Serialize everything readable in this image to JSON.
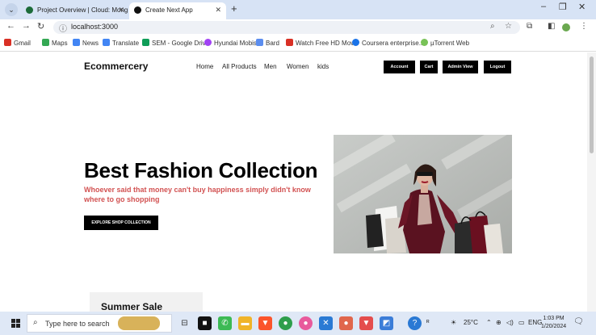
{
  "browser": {
    "tabs": [
      {
        "title": "Project Overview | Cloud: Mong",
        "active": false
      },
      {
        "title": "Create Next App",
        "active": true
      }
    ],
    "new_tab": "+",
    "address": "localhost:3000",
    "bookmarks": [
      {
        "label": "Gmail",
        "icon": "gmail-icon",
        "color": "#d93025"
      },
      {
        "label": "Maps",
        "icon": "maps-icon",
        "color": "#34a853"
      },
      {
        "label": "News",
        "icon": "news-icon",
        "color": "#4285f4"
      },
      {
        "label": "Translate",
        "icon": "translate-icon",
        "color": "#4285f4"
      },
      {
        "label": "SEM - Google Drive",
        "icon": "drive-icon",
        "color": "#0f9d58"
      },
      {
        "label": "Hyundai Mobis",
        "icon": "hyundai-icon",
        "color": "#a142f4"
      },
      {
        "label": "Bard",
        "icon": "bard-icon",
        "color": "#5b8def"
      },
      {
        "label": "Watch Free HD Mov...",
        "icon": "movie-icon",
        "color": "#d93025"
      },
      {
        "label": "Coursera enterprise...",
        "icon": "coursera-icon",
        "color": "#1a73e8"
      },
      {
        "label": "µTorrent Web",
        "icon": "utorrent-icon",
        "color": "#78c257"
      }
    ]
  },
  "site": {
    "brand": "Ecommercery",
    "nav": [
      "Home",
      "All Products",
      "Men",
      "Women",
      "kids"
    ],
    "buttons": [
      "Account",
      "Cart",
      "Admin View",
      "Logout"
    ]
  },
  "hero": {
    "title": "Best Fashion Collection",
    "subtitle": "Whoever said that money can't buy happiness simply didn't know where to go shopping",
    "cta": "EXPLORE SHOP COLLECTION"
  },
  "section": {
    "title": "Summer Sale"
  },
  "taskbar": {
    "search_placeholder": "Type here to search",
    "weather": "25°C",
    "language": "ENG",
    "time": "1:03 PM",
    "date": "1/20/2024"
  },
  "colors": {
    "accent_red": "#d25252",
    "tab_strip": "#d7e3f5",
    "taskbar": "#dfe8f6"
  }
}
